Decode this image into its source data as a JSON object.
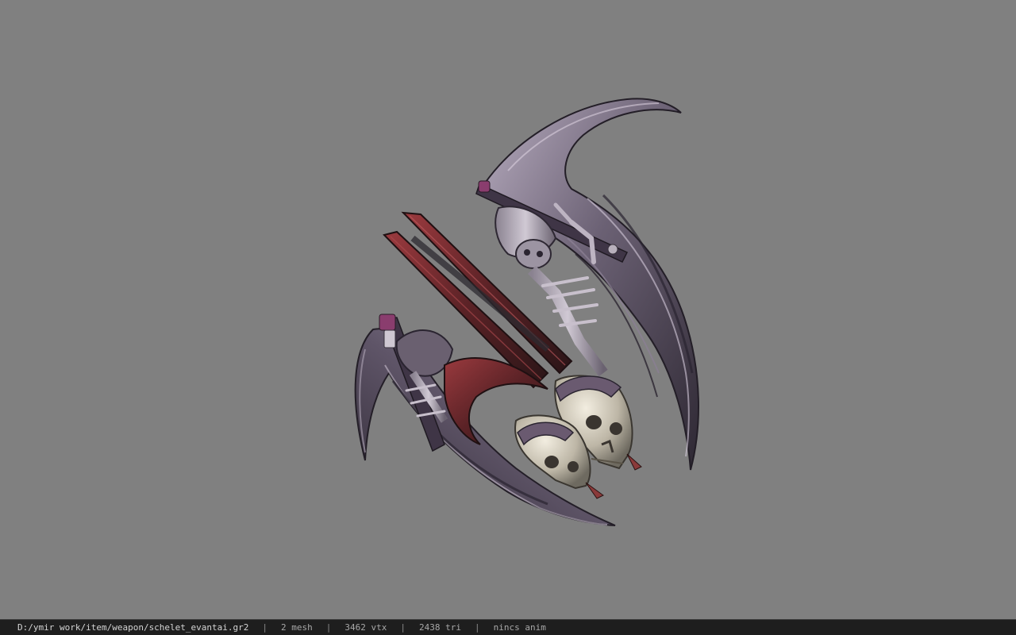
{
  "status_bar": {
    "file_path": "D:/ymir work/item/weapon/schelet_evantai.gr2",
    "separator": "|",
    "mesh_count": "2 mesh",
    "vertex_count": "3462 vtx",
    "triangle_count": "2438 tri",
    "animation": "nincs anim"
  },
  "viewport": {
    "background_color": "#808080",
    "model_palette": {
      "blade_dark": "#3a3340",
      "blade_mid": "#6a5f72",
      "blade_light": "#b3a9bb",
      "accent_red": "#7a2a2e",
      "bone": "#d8d2c2"
    }
  }
}
